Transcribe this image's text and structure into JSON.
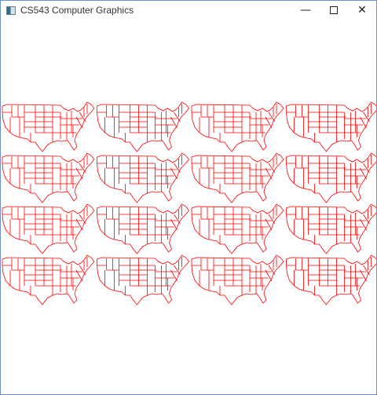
{
  "window": {
    "title": "CS543 Computer Graphics",
    "controls": {
      "minimize_icon": "minimize-icon",
      "maximize_icon": "maximize-icon",
      "close_icon": "close-icon"
    }
  },
  "canvas": {
    "content": "tiled-us-state-map",
    "tile_rows": 4,
    "tile_cols": 4,
    "line_color": "#ff0000",
    "background": "#ffffff"
  }
}
